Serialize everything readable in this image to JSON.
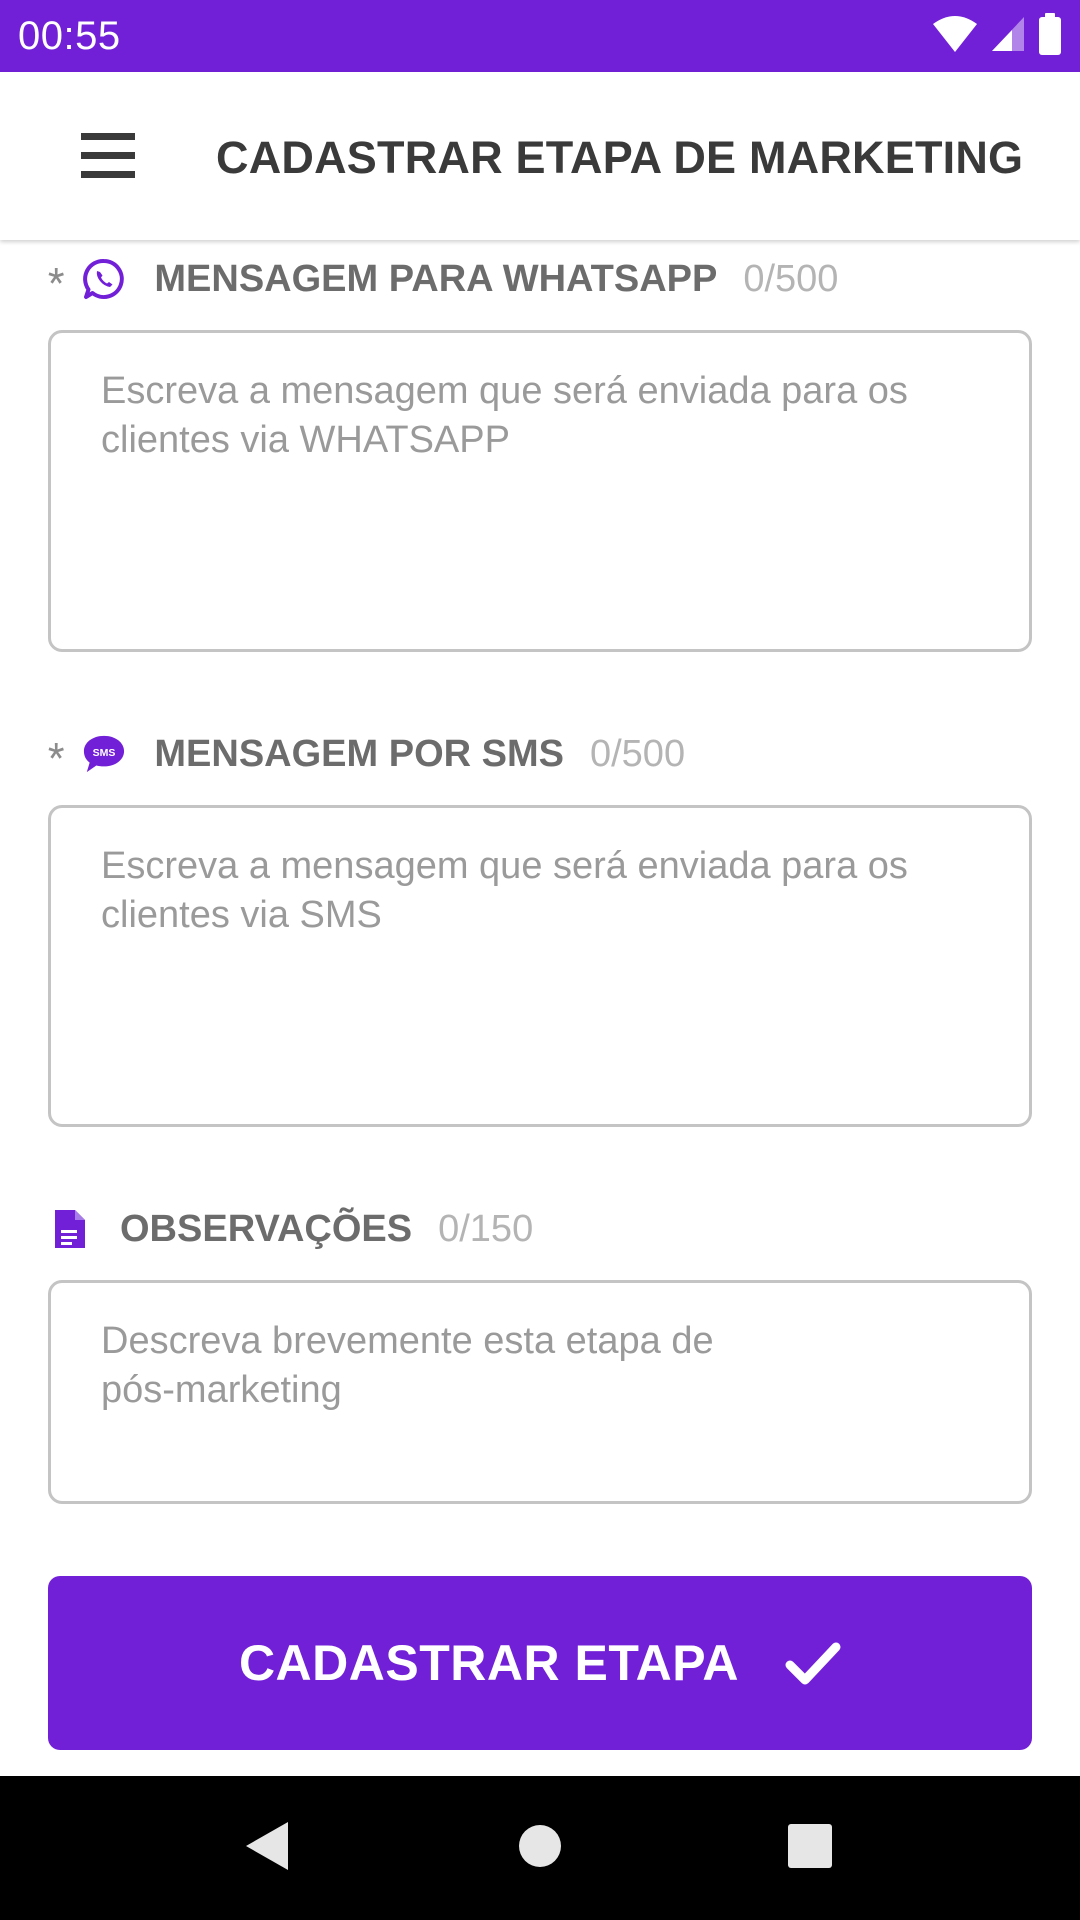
{
  "status_bar": {
    "time": "00:55",
    "background": "#7220D8",
    "icons": [
      "wifi-icon",
      "signal-icon",
      "battery-icon"
    ]
  },
  "app_bar": {
    "title": "CADASTRAR ETAPA DE MARKETING",
    "menu_icon": "menu-icon"
  },
  "fields": {
    "whatsapp": {
      "required_mark": "*",
      "label": "MENSAGEM PARA WHATSAPP",
      "counter": "0/500",
      "placeholder": "Escreva a mensagem que será enviada para os clientes via WHATSAPP",
      "icon": "whatsapp-icon"
    },
    "sms": {
      "required_mark": "*",
      "label": "MENSAGEM POR SMS",
      "counter": "0/500",
      "placeholder": "Escreva a mensagem que será enviada para os clientes via SMS",
      "icon": "sms-icon",
      "icon_text": "SMS"
    },
    "notes": {
      "label": "OBSERVAÇÕES",
      "counter": "0/150",
      "placeholder": "Descreva brevemente esta etapa de pós-marketing",
      "icon": "document-icon"
    }
  },
  "submit": {
    "label": "CADASTRAR ETAPA",
    "icon": "check-icon"
  },
  "nav_bar": {
    "buttons": [
      "back-icon",
      "home-icon",
      "recents-icon"
    ]
  },
  "colors": {
    "accent": "#7220D8",
    "label": "#6c6c6c",
    "counter": "#b4b4b4",
    "placeholder": "#9a9a9a",
    "border": "#c4c4c4"
  }
}
